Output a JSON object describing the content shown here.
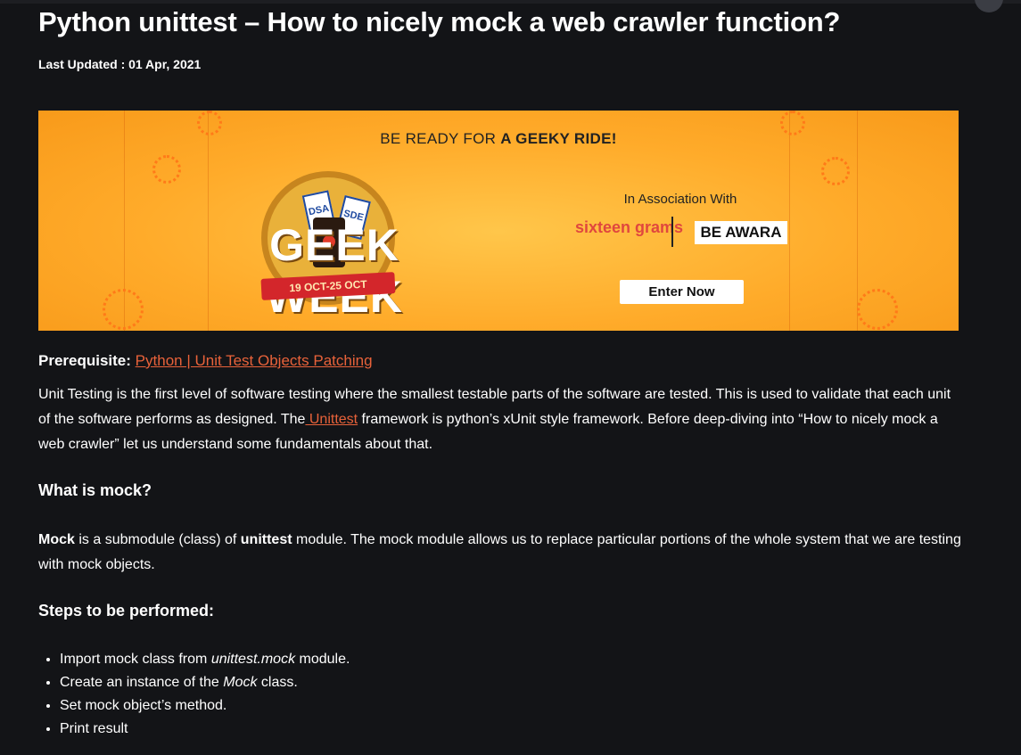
{
  "article": {
    "title": "Python unittest – How to nicely mock a web crawler function?",
    "last_updated": "Last Updated : 01 Apr, 2021"
  },
  "banner": {
    "headline_prefix": "BE READY FOR ",
    "headline_bold": "A GEEKY RIDE!",
    "event_name": "GEEK WEEK",
    "event_dates": "19 OCT-25 OCT",
    "ticket_labels": [
      "DSA",
      "SDE"
    ],
    "association_label": "In Association With",
    "partner_1": "sixteen grams",
    "partner_2": "BE AWARA",
    "cta_label": "Enter Now",
    "colors": {
      "background": "#ffab2a",
      "accent": "#d3262b"
    }
  },
  "prerequisite": {
    "label": "Prerequisite:",
    "link_text": "Python | Unit Test Objects Patching"
  },
  "intro": {
    "part1": "Unit Testing is the first level of software testing where the smallest testable parts of the software are tested. This is used to validate that each unit of the software performs as designed. The",
    "link_text": " Unittest",
    "part2": " framework is python’s xUnit style framework. Before deep-diving into “How to nicely mock a web crawler” let us understand some fundamentals about that."
  },
  "section_mock": {
    "heading": "What is mock?",
    "bold1": "Mock",
    "text1": " is a submodule (class) of ",
    "bold2": "unittest",
    "text2": " module. The mock module allows us to replace particular portions of the whole system that we are testing with mock objects."
  },
  "section_steps": {
    "heading": "Steps to be performed:",
    "items": [
      {
        "before": "Import mock class from ",
        "em": "unittest.mock",
        "after": " module."
      },
      {
        "before": "Create an instance of the ",
        "em": "Mock",
        "after": " class."
      },
      {
        "before": "Set mock object’s method.",
        "em": "",
        "after": ""
      },
      {
        "before": "Print result",
        "em": "",
        "after": ""
      }
    ]
  }
}
